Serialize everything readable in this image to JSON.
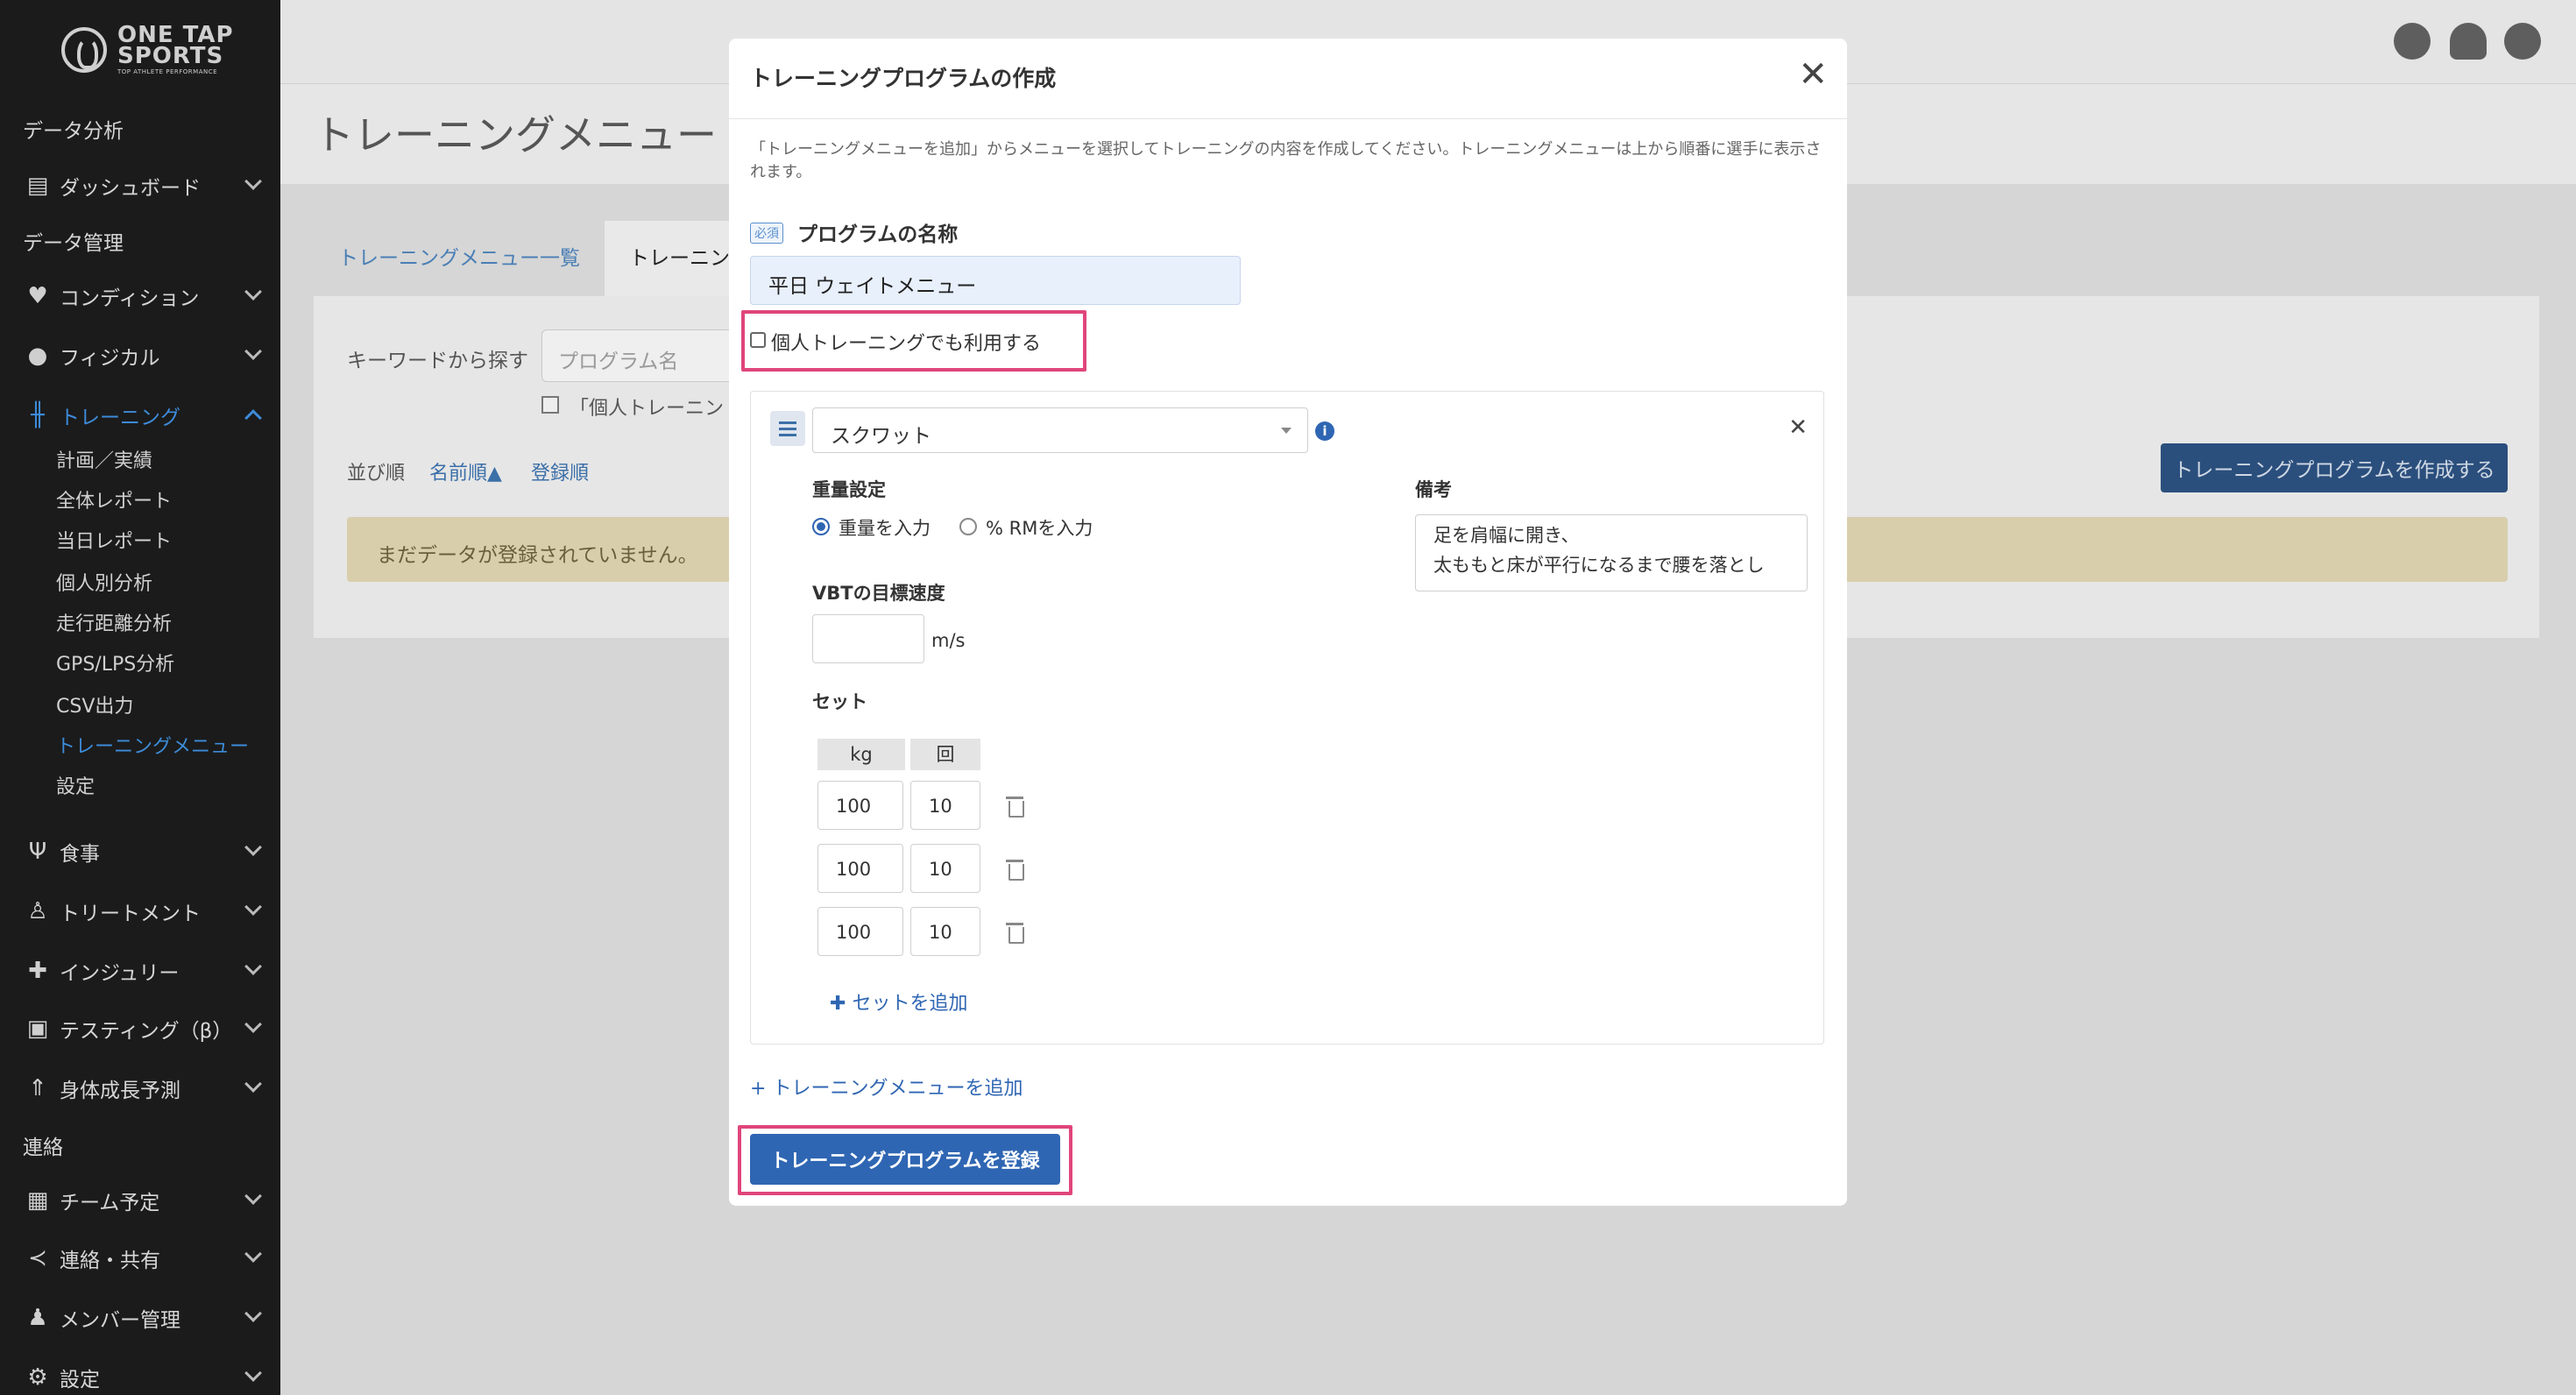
{
  "brand": {
    "line1": "ONE TAP",
    "line2": "SPORTS",
    "tagline": "TOP ATHLETE PERFORMANCE"
  },
  "sidebar": {
    "sections": [
      "データ分析",
      "データ管理",
      "連絡"
    ],
    "items": [
      {
        "label": "ダッシュボード",
        "icon": "id-card-icon"
      },
      {
        "label": "コンディション",
        "icon": "heart-pulse-icon"
      },
      {
        "label": "フィジカル",
        "icon": "user-circle-icon"
      },
      {
        "label": "トレーニング",
        "icon": "dumbbell-icon"
      },
      {
        "label": "食事",
        "icon": "utensils-icon"
      },
      {
        "label": "トリートメント",
        "icon": "user-medical-icon"
      },
      {
        "label": "インジュリー",
        "icon": "first-aid-icon"
      },
      {
        "label": "テスティング（β）",
        "icon": "chart-user-icon"
      },
      {
        "label": "身体成長予測",
        "icon": "child-growth-icon"
      },
      {
        "label": "チーム予定",
        "icon": "calendar-icon"
      },
      {
        "label": "連絡・共有",
        "icon": "share-icon"
      },
      {
        "label": "メンバー管理",
        "icon": "user-icon"
      },
      {
        "label": "設定",
        "icon": "gear-icon"
      }
    ],
    "training_sub": [
      "計画／実績",
      "全体レポート",
      "当日レポート",
      "個人別分析",
      "走行距離分析",
      "GPS/LPS分析",
      "CSV出力",
      "トレーニングメニュー",
      "設定"
    ]
  },
  "page": {
    "title": "トレーニングメニュー",
    "tabs": [
      "トレーニングメニュー一覧",
      "トレーニング"
    ],
    "keyword_label": "キーワードから探す",
    "keyword_placeholder": "プログラム名",
    "filter_label": "「個人トレーニン",
    "sort_label": "並び順",
    "sort_name": "名前順▲",
    "sort_registered": "登録順",
    "create_button": "トレーニングプログラムを作成する",
    "empty_message": "まだデータが登録されていません。"
  },
  "modal": {
    "title": "トレーニングプログラムの作成",
    "close": "✕",
    "description": "「トレーニングメニューを追加」からメニューを選択してトレーニングの内容を作成してください。トレーニングメニューは上から順番に選手に表示されます。",
    "required_badge": "必須",
    "program_name_label": "プログラムの名称",
    "program_name_value": "平日 ウェイトメニュー",
    "individual_label": "個人トレーニングでも利用する",
    "exercise": {
      "selected": "スクワット",
      "weight_setting_label": "重量設定",
      "radio_weight": "重量を入力",
      "radio_rm": "% RMを入力",
      "vbt_label": "VBTの目標速度",
      "vbt_unit": "m/s",
      "sets_label": "セット",
      "col_kg": "kg",
      "col_reps": "回",
      "sets": [
        {
          "kg": "100",
          "reps": "10"
        },
        {
          "kg": "100",
          "reps": "10"
        },
        {
          "kg": "100",
          "reps": "10"
        }
      ],
      "add_set": "セットを追加",
      "memo_label": "備考",
      "memo_line1": "足を肩幅に開き、",
      "memo_line2": "太ももと床が平行になるまで腰を落とし"
    },
    "add_menu": "トレーニングメニューを追加",
    "submit": "トレーニングプログラムを登録"
  }
}
